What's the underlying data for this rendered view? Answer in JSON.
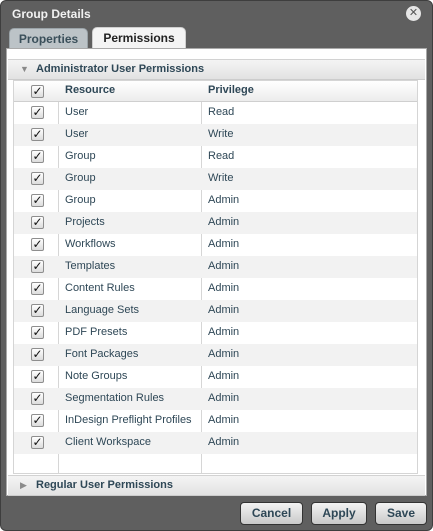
{
  "window": {
    "title": "Group Details",
    "close_glyph": "✕"
  },
  "tabs": [
    {
      "label": "Properties",
      "active": false
    },
    {
      "label": "Permissions",
      "active": true
    }
  ],
  "admin_section": {
    "label": "Administrator User Permissions",
    "expanded": true,
    "header_checked": true,
    "columns": {
      "resource": "Resource",
      "privilege": "Privilege"
    },
    "rows": [
      {
        "resource": "User",
        "privilege": "Read",
        "checked": true
      },
      {
        "resource": "User",
        "privilege": "Write",
        "checked": true
      },
      {
        "resource": "Group",
        "privilege": "Read",
        "checked": true
      },
      {
        "resource": "Group",
        "privilege": "Write",
        "checked": true
      },
      {
        "resource": "Group",
        "privilege": "Admin",
        "checked": true
      },
      {
        "resource": "Projects",
        "privilege": "Admin",
        "checked": true
      },
      {
        "resource": "Workflows",
        "privilege": "Admin",
        "checked": true
      },
      {
        "resource": "Templates",
        "privilege": "Admin",
        "checked": true
      },
      {
        "resource": "Content Rules",
        "privilege": "Admin",
        "checked": true
      },
      {
        "resource": "Language Sets",
        "privilege": "Admin",
        "checked": true
      },
      {
        "resource": "PDF Presets",
        "privilege": "Admin",
        "checked": true
      },
      {
        "resource": "Font Packages",
        "privilege": "Admin",
        "checked": true
      },
      {
        "resource": "Note Groups",
        "privilege": "Admin",
        "checked": true
      },
      {
        "resource": "Segmentation Rules",
        "privilege": "Admin",
        "checked": true
      },
      {
        "resource": "InDesign Preflight Profiles",
        "privilege": "Admin",
        "checked": true
      },
      {
        "resource": "Client Workspace",
        "privilege": "Admin",
        "checked": true
      }
    ]
  },
  "regular_section": {
    "label": "Regular User Permissions",
    "expanded": false
  },
  "buttons": {
    "cancel": "Cancel",
    "apply": "Apply",
    "save": "Save"
  },
  "icons": {
    "expanded": "triangle-down-icon",
    "collapsed": "triangle-right-icon",
    "check": "checkmark-icon"
  },
  "colors": {
    "dialog_bg": "#5f5f5f",
    "label_text": "#2e4756",
    "alt_row": "#f2f2f2"
  }
}
